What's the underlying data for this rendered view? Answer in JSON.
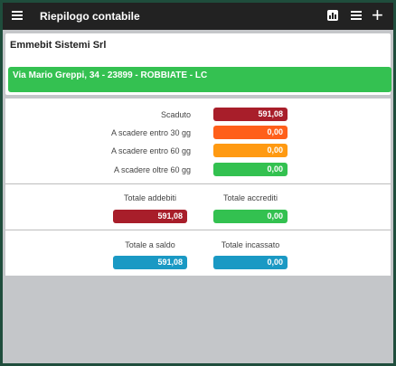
{
  "appbar": {
    "title": "Riepilogo contabile",
    "icons": [
      "menu-icon",
      "chart-icon",
      "list-icon",
      "plus-icon"
    ]
  },
  "client": {
    "name": "Emmebit Sistemi Srl",
    "address": "Via Mario Greppi, 34 - 23899 - ROBBIATE - LC"
  },
  "aging": [
    {
      "label": "Scaduto",
      "value": "591,08",
      "color": "#a81e2a"
    },
    {
      "label": "A scadere entro 30 gg",
      "value": "0,00",
      "color": "#ff5f1a"
    },
    {
      "label": "A scadere entro 60 gg",
      "value": "0,00",
      "color": "#ff9a12"
    },
    {
      "label": "A scadere oltre 60 gg",
      "value": "0,00",
      "color": "#33c150"
    }
  ],
  "totals": {
    "addebiti_label": "Totale addebiti",
    "addebiti_value": "591,08",
    "accrediti_label": "Totale accrediti",
    "accrediti_value": "0,00",
    "saldo_label": "Totale a saldo",
    "saldo_value": "591,08",
    "incassato_label": "Totale incassato",
    "incassato_value": "0,00"
  }
}
